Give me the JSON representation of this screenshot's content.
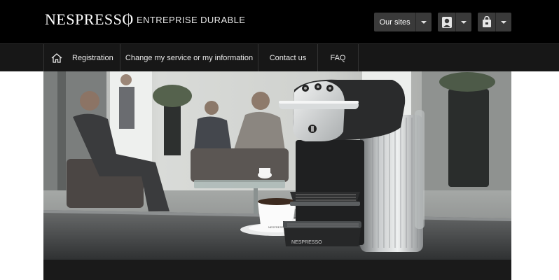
{
  "header": {
    "brand": "NESPRESSO",
    "tagline": "ENTREPRISE DURABLE",
    "our_sites_label": "Our sites",
    "user_icon": "user-icon",
    "bag_icon": "shopping-bag-icon"
  },
  "nav": {
    "home_icon": "home-icon",
    "items": [
      {
        "label": "Registration"
      },
      {
        "label": "Change my service or my information"
      },
      {
        "label": "Contact us"
      },
      {
        "label": "FAQ"
      }
    ]
  },
  "hero": {
    "machine_brand": "NESPRESSO",
    "cup_brand": "NESPRESSO"
  },
  "colors": {
    "header_bg": "#000000",
    "nav_bg": "#171717",
    "button_bg": "#3a3a3a"
  }
}
